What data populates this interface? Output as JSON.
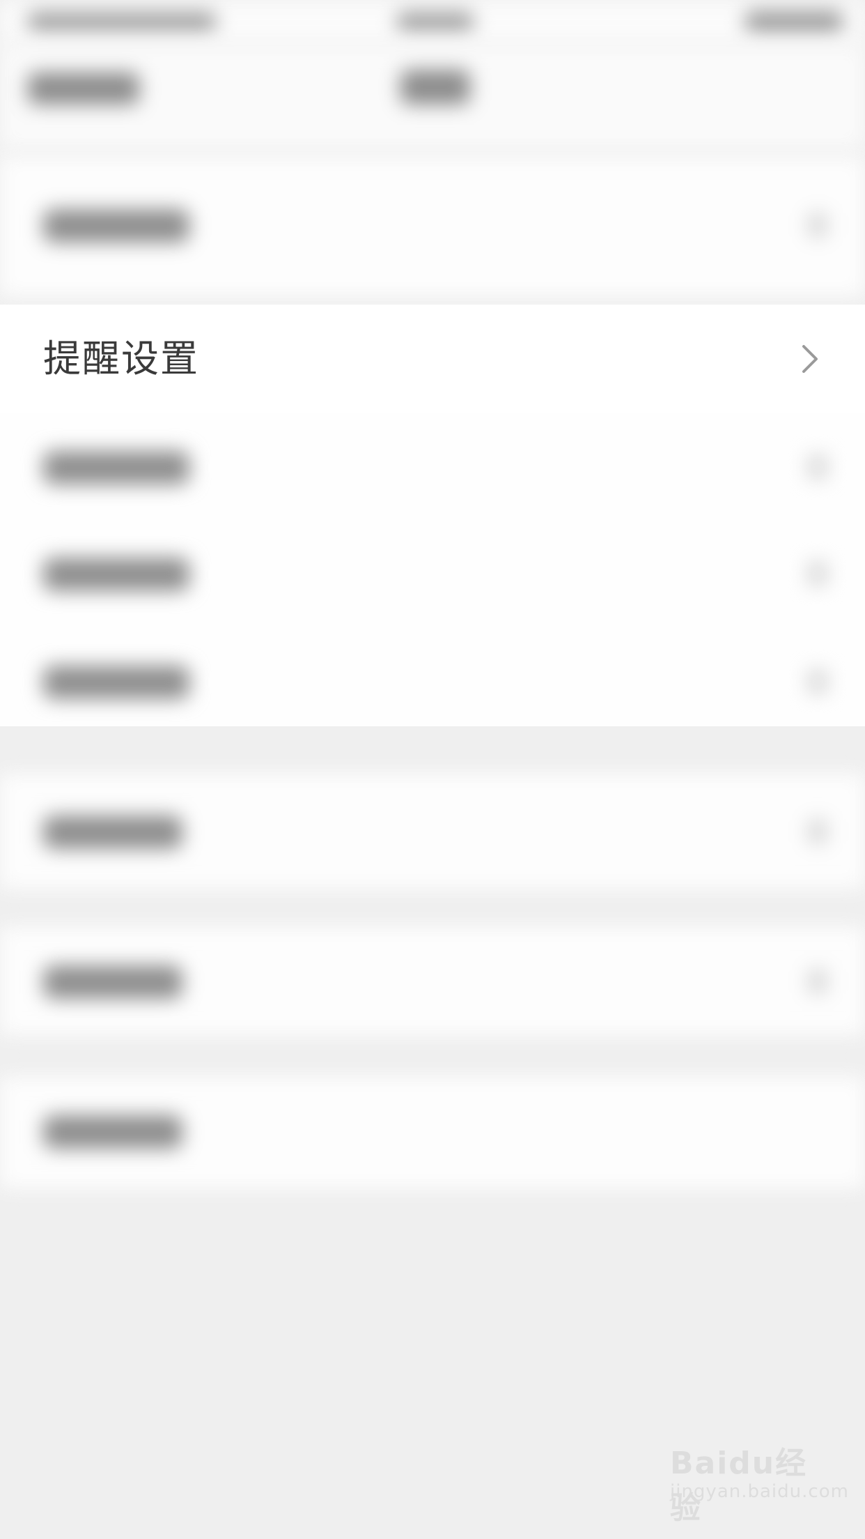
{
  "settings": {
    "items": [
      {
        "label": "提醒设置"
      }
    ]
  },
  "watermark": {
    "line1": "Baidu经验",
    "line2": "jingyan.baidu.com"
  },
  "icons": {
    "chevron": "chevron-right-icon"
  }
}
